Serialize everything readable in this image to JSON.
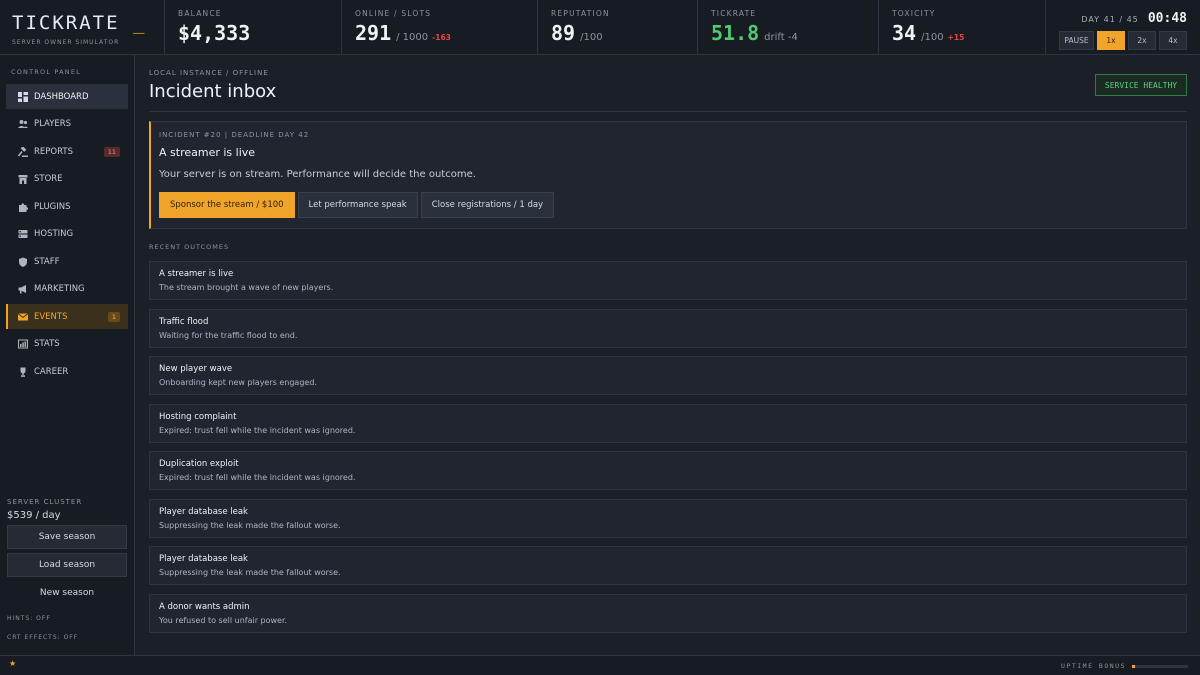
{
  "brand": {
    "name": "TICKRATE",
    "cursor": "_",
    "subtitle": "SERVER OWNER SIMULATOR"
  },
  "stats": {
    "balance": {
      "label": "BALANCE",
      "value": "$4,333"
    },
    "online": {
      "label": "ONLINE / SLOTS",
      "value": "291",
      "slots": "/ 1000",
      "delta": "-163"
    },
    "reputation": {
      "label": "REPUTATION",
      "value": "89",
      "max": "/100"
    },
    "tickrate": {
      "label": "TICKRATE",
      "value": "51.8",
      "drift": "drift -4"
    },
    "toxicity": {
      "label": "TOXICITY",
      "value": "34",
      "max": "/100",
      "delta": "+15"
    }
  },
  "clock": {
    "day": "DAY 41 / 45",
    "time": "00:48"
  },
  "speed": {
    "pause": "PAUSE",
    "x1": "1x",
    "x2": "2x",
    "x4": "4x",
    "active": "1x"
  },
  "sidebar": {
    "title": "CONTROL PANEL",
    "items": [
      {
        "label": "DASHBOARD",
        "icon": "grid-icon"
      },
      {
        "label": "PLAYERS",
        "icon": "users-icon"
      },
      {
        "label": "REPORTS",
        "icon": "gavel-icon",
        "badge": "11"
      },
      {
        "label": "STORE",
        "icon": "store-icon"
      },
      {
        "label": "PLUGINS",
        "icon": "puzzle-icon"
      },
      {
        "label": "HOSTING",
        "icon": "server-icon"
      },
      {
        "label": "STAFF",
        "icon": "shield-icon"
      },
      {
        "label": "MARKETING",
        "icon": "megaphone-icon"
      },
      {
        "label": "EVENTS",
        "icon": "mail-icon",
        "badge": "1"
      },
      {
        "label": "STATS",
        "icon": "chart-icon"
      },
      {
        "label": "CAREER",
        "icon": "trophy-icon"
      }
    ],
    "cluster_title": "SERVER CLUSTER",
    "cluster_cost": "$539 / day",
    "save": "Save season",
    "load": "Load season",
    "new": "New season",
    "hints": "HINTS: OFF",
    "crt": "CRT EFFECTS: OFF"
  },
  "main": {
    "crumb": "LOCAL INSTANCE / OFFLINE",
    "title": "Incident inbox",
    "status": "SERVICE HEALTHY",
    "incident": {
      "meta": "INCIDENT #20 | DEADLINE DAY 42",
      "title": "A streamer is live",
      "desc": "Your server is on stream. Performance will decide the outcome.",
      "choices": [
        "Sponsor the stream / $100",
        "Let performance speak",
        "Close registrations / 1 day"
      ]
    },
    "recent_label": "RECENT OUTCOMES",
    "outcomes": [
      {
        "title": "A streamer is live",
        "text": "The stream brought a wave of new players."
      },
      {
        "title": "Traffic flood",
        "text": "Waiting for the traffic flood to end."
      },
      {
        "title": "New player wave",
        "text": "Onboarding kept new players engaged."
      },
      {
        "title": "Hosting complaint",
        "text": "Expired: trust fell while the incident was ignored."
      },
      {
        "title": "Duplication exploit",
        "text": "Expired: trust fell while the incident was ignored."
      },
      {
        "title": "Player database leak",
        "text": "Suppressing the leak made the fallout worse."
      },
      {
        "title": "Player database leak",
        "text": "Suppressing the leak made the fallout worse."
      },
      {
        "title": "A donor wants admin",
        "text": "You refused to sell unfair power."
      }
    ]
  },
  "footer": {
    "star": "★",
    "uptime": "UPTIME BONUS",
    "uptime_fraction": 0.05
  },
  "colors": {
    "accent": "#f0a52a",
    "good": "#4ecb71",
    "bad": "#e04848"
  }
}
